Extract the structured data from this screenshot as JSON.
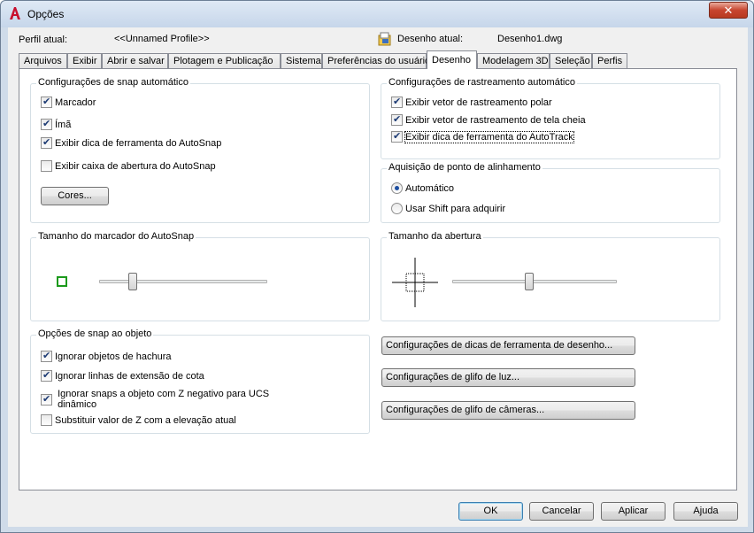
{
  "window": {
    "title": "Opções"
  },
  "profile": {
    "label": "Perfil atual:",
    "value": "<<Unnamed Profile>>"
  },
  "drawing": {
    "label": "Desenho atual:",
    "value": "Desenho1.dwg"
  },
  "tabs": [
    {
      "label": "Arquivos"
    },
    {
      "label": "Exibir"
    },
    {
      "label": "Abrir e salvar"
    },
    {
      "label": "Plotagem e Publicação"
    },
    {
      "label": "Sistema"
    },
    {
      "label": "Preferências do usuário"
    },
    {
      "label": "Desenho",
      "active": true
    },
    {
      "label": "Modelagem 3D"
    },
    {
      "label": "Seleção"
    },
    {
      "label": "Perfis"
    }
  ],
  "autosnap": {
    "title": "Configurações de snap automático",
    "marker": {
      "label": "Marcador",
      "checked": true
    },
    "magnet": {
      "label": "Ímã",
      "checked": true
    },
    "tooltip": {
      "label": "Exibir dica de ferramenta do AutoSnap",
      "checked": true
    },
    "aperture_box": {
      "label": "Exibir caixa de abertura do AutoSnap",
      "checked": false
    },
    "colors_button": "Cores..."
  },
  "autotrack": {
    "title": "Configurações de rastreamento automático",
    "polar": {
      "label": "Exibir vetor de rastreamento polar",
      "checked": true
    },
    "fullscreen": {
      "label": "Exibir vetor de rastreamento de tela cheia",
      "checked": true
    },
    "tooltip": {
      "label": "Exibir dica de ferramenta do AutoTrack",
      "checked": true
    }
  },
  "alignment": {
    "title": "Aquisição de ponto de alinhamento",
    "automatic": {
      "label": "Automático",
      "selected": true
    },
    "shift": {
      "label": "Usar Shift para adquirir",
      "selected": false
    }
  },
  "marker_size": {
    "title": "Tamanho do marcador do AutoSnap",
    "value": 0.2,
    "preview_color": "#1c9a1c"
  },
  "aperture_size": {
    "title": "Tamanho da abertura",
    "value": 0.47
  },
  "osnap": {
    "title": "Opções de snap ao objeto",
    "hatch": {
      "label": "Ignorar objetos de hachura",
      "checked": true
    },
    "dimext": {
      "label": "Ignorar linhas de extensão de cota",
      "checked": true
    },
    "negz": {
      "label_line1": "Ignorar snaps a objeto com Z negativo para UCS",
      "label_line2": "dinâmico",
      "checked": true
    },
    "replace_z": {
      "label": "Substituir valor de Z com a elevação atual",
      "checked": false
    }
  },
  "side_buttons": {
    "drafting_tooltip": "Configurações de dicas de ferramenta de desenho...",
    "light_glyph": "Configurações de glifo de luz...",
    "camera_glyph": "Configurações de glifo de câmeras..."
  },
  "footer": {
    "ok": "OK",
    "cancel": "Cancelar",
    "apply": "Aplicar",
    "help": "Ajuda"
  },
  "colors": {
    "accent": "#1d4ea0",
    "title_icon": "#c8102e",
    "marker": "#1c9a1c"
  }
}
